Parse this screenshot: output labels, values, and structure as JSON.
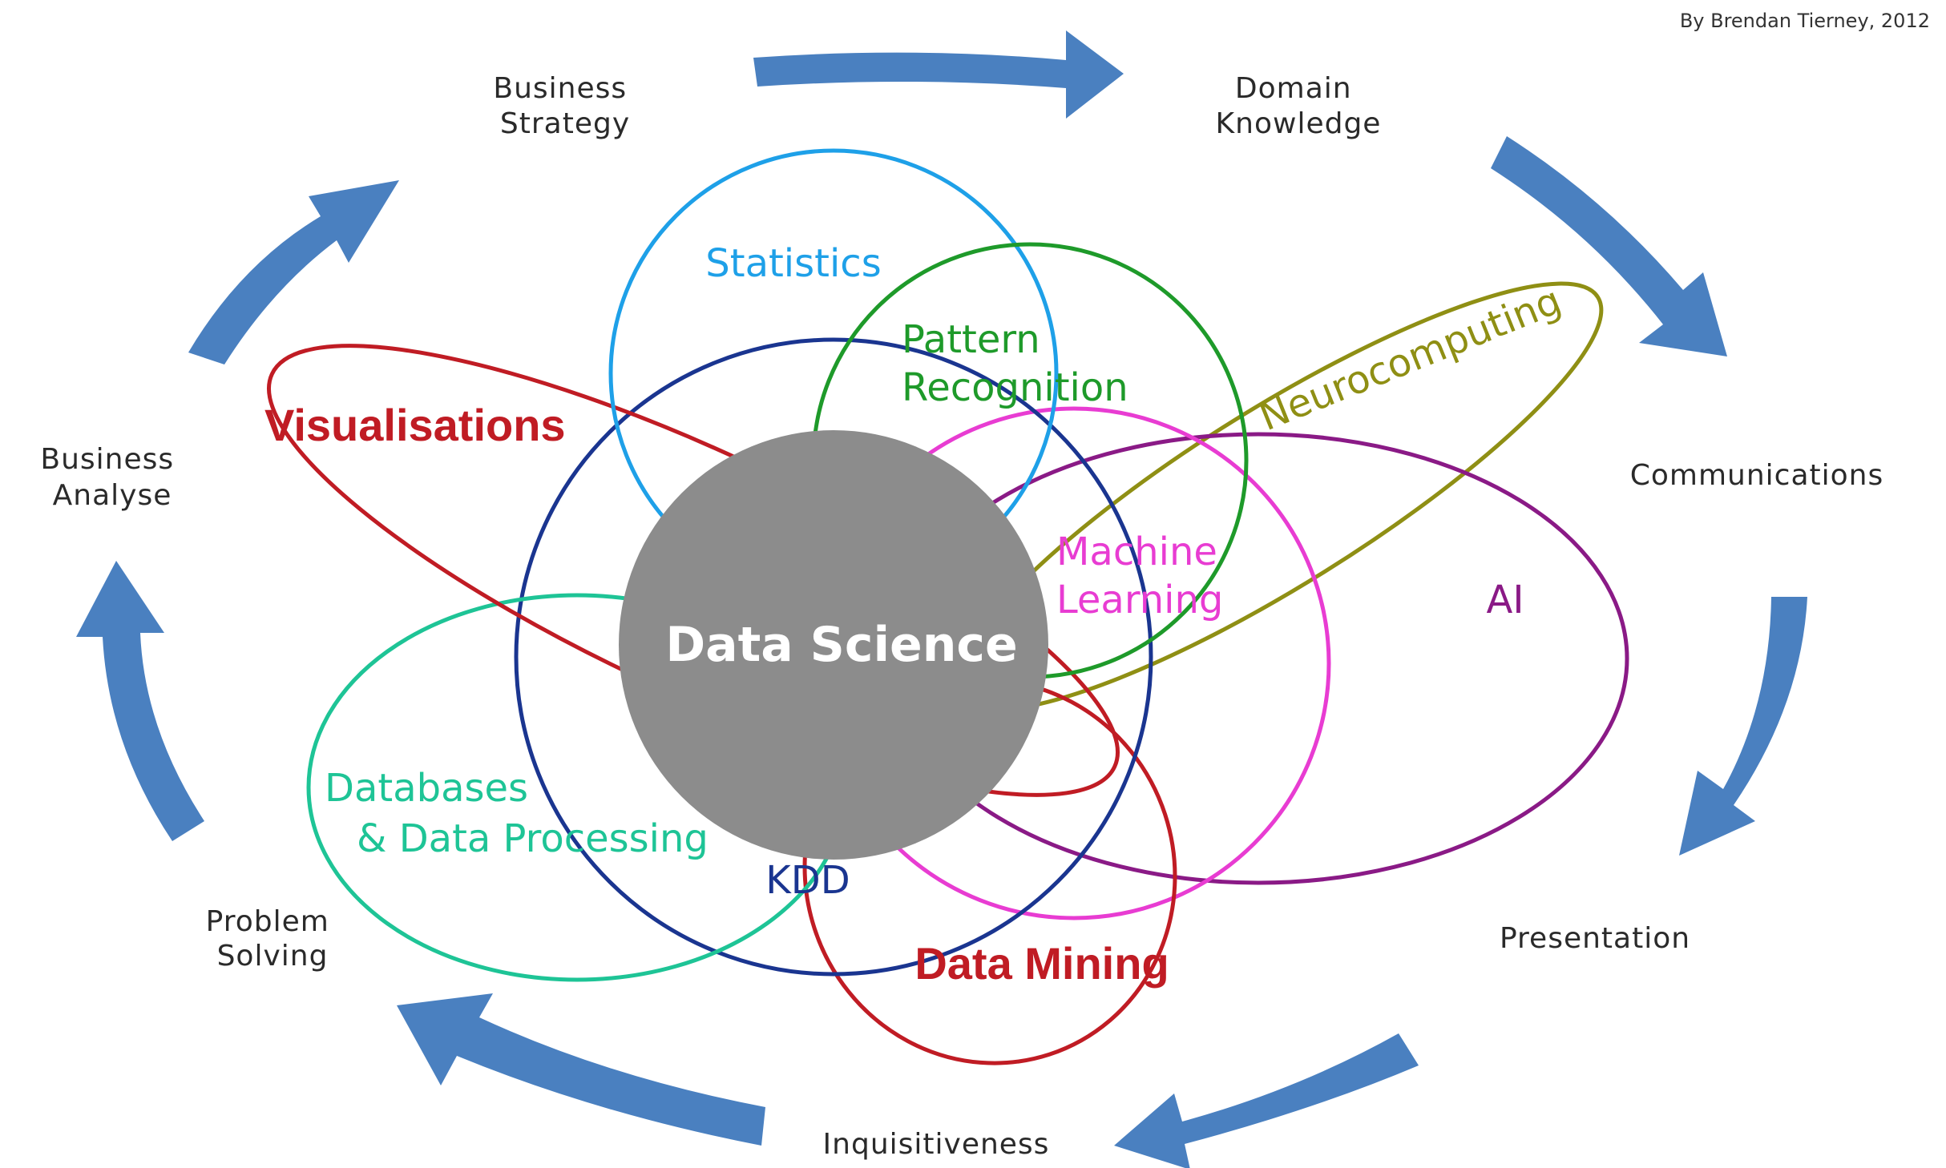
{
  "credit": "By Brendan Tierney, 2012",
  "center": {
    "label": "Data Science",
    "color": "#8c8c8c"
  },
  "cycle": {
    "arrow_color": "#4a80c0",
    "labels": {
      "business_strategy": [
        "Business",
        "Strategy"
      ],
      "domain_knowledge": [
        "Domain",
        "Knowledge"
      ],
      "communications": [
        "Communications"
      ],
      "presentation": [
        "Presentation"
      ],
      "inquisitiveness": [
        "Inquisitiveness"
      ],
      "problem_solving": [
        "Problem",
        "Solving"
      ],
      "business_analyse": [
        "Business",
        "Analyse"
      ]
    }
  },
  "fields": {
    "statistics": {
      "label": "Statistics",
      "color": "#1ea0e8"
    },
    "pattern_recognition": {
      "label_line1": "Pattern",
      "label_line2": "Recognition",
      "color": "#1e9a2a"
    },
    "neurocomputing": {
      "label": "Neurocomputing",
      "color": "#8f8f14"
    },
    "visualisations": {
      "label": "Visualisations",
      "color": "#c01c24"
    },
    "machine_learning": {
      "label_line1": "Machine",
      "label_line2": "Learning",
      "color": "#e83cd2"
    },
    "ai": {
      "label": "AI",
      "color": "#8a1a86"
    },
    "kdd": {
      "label": "KDD",
      "color": "#1a3590"
    },
    "databases": {
      "label_line1": "Databases",
      "label_line2": "& Data Processing",
      "color": "#1ec496"
    },
    "data_mining": {
      "label": "Data Mining",
      "color": "#c01c24"
    }
  }
}
